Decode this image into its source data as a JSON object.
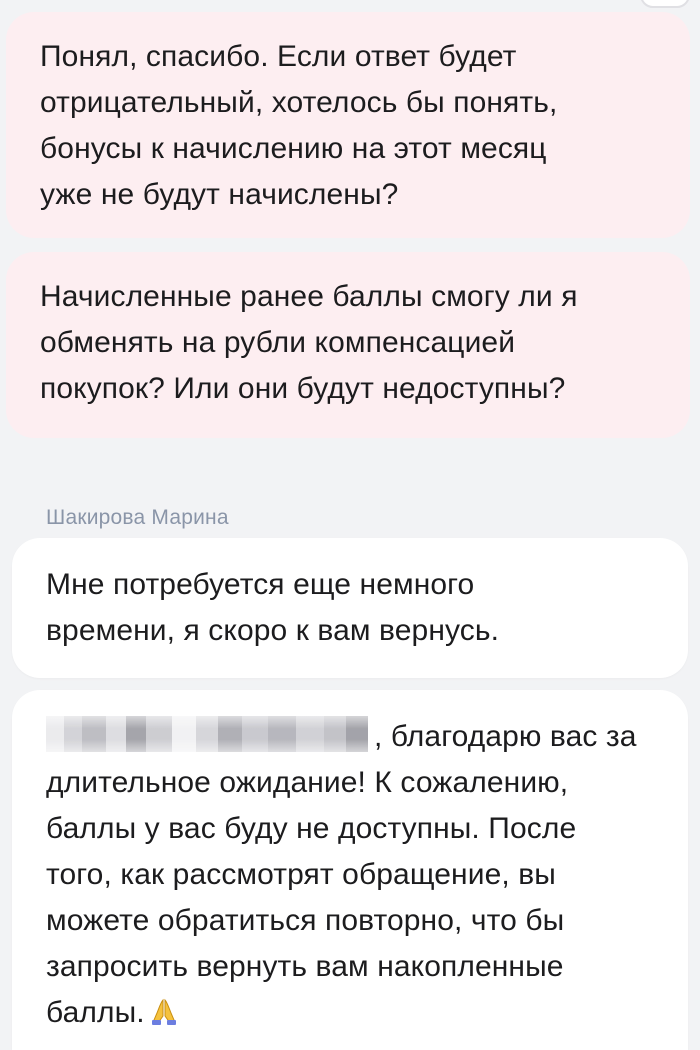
{
  "messages": [
    {
      "role": "user",
      "lines": [
        "Понял, спасибо. Если ответ будет",
        "отрицательный, хотелось бы понять,",
        "бонусы к начислению на этот месяц",
        "уже не будут начислены?"
      ]
    },
    {
      "role": "user",
      "lines": [
        "Начисленные ранее баллы смогу ли я",
        "обменять на рубли компенсацией",
        "покупок? Или они будут недоступны?"
      ]
    },
    {
      "role": "agent",
      "sender": "Шакирова Марина",
      "lines": [
        "Мне потребуется еще немного",
        "времени, я скоро к вам вернусь."
      ]
    },
    {
      "role": "agent",
      "redacted_name": true,
      "lines": [
        ", благодарю вас за",
        "длительное ожидание! К сожалению,",
        "баллы у вас буду не доступны. После",
        "того, как рассмотрят обращение, вы",
        "можете обратиться повторно, что бы",
        "запросить вернуть вам накопленные",
        "баллы."
      ],
      "trailing_icon": "folded-hands-emoji-icon"
    }
  ],
  "colors": {
    "user_bubble": "#fdeef1",
    "agent_bubble": "#ffffff",
    "background": "#f2f3f5",
    "sender_name": "#8a95a8",
    "text": "#1c1c1e"
  }
}
